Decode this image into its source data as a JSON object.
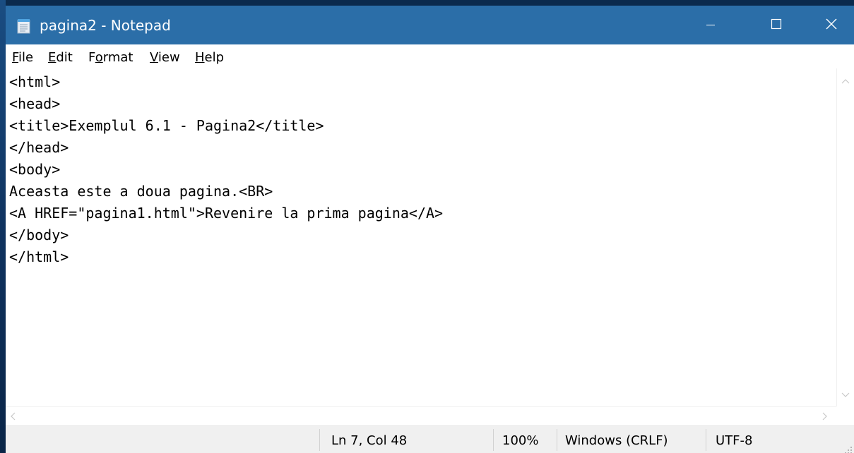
{
  "window": {
    "title": "pagina2 - Notepad",
    "app_icon": "notepad-icon",
    "controls": {
      "minimize_icon": "minimize-icon",
      "maximize_icon": "maximize-icon",
      "close_icon": "close-icon"
    },
    "title_bar_color": "#2b6ea8"
  },
  "menu": {
    "items": [
      {
        "hotkey": "F",
        "rest": "ile"
      },
      {
        "hotkey": "E",
        "rest": "dit"
      },
      {
        "pre": "F",
        "hotkey": "o",
        "rest": "rmat"
      },
      {
        "hotkey": "V",
        "rest": "iew"
      },
      {
        "hotkey": "H",
        "rest": "elp"
      }
    ]
  },
  "editor": {
    "lines": [
      "<html>",
      "<head>",
      "<title>Exemplul 6.1 - Pagina2</title>",
      "</head>",
      "<body>",
      "Aceasta este a doua pagina.<BR>",
      "<A HREF=\"pagina1.html\">Revenire la prima pagina</A>",
      "</body>",
      "</html>"
    ]
  },
  "status_bar": {
    "position": "Ln 7, Col 48",
    "zoom": "100%",
    "line_ending": "Windows (CRLF)",
    "encoding": "UTF-8"
  }
}
